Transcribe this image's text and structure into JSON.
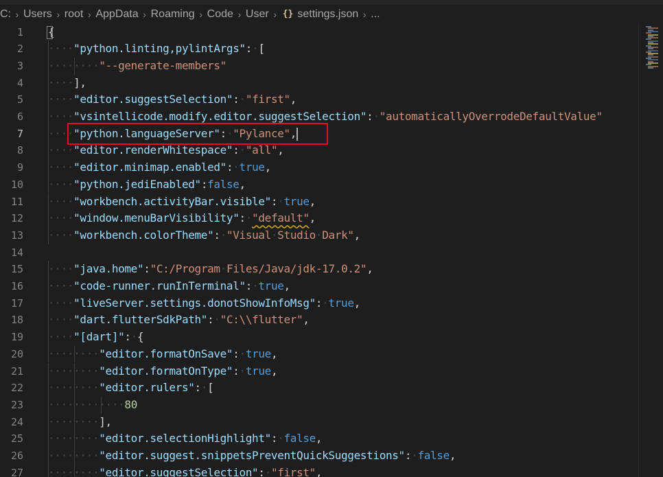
{
  "breadcrumb": {
    "items": [
      "C:",
      "Users",
      "root",
      "AppData",
      "Roaming",
      "Code",
      "User",
      "settings.json",
      "..."
    ],
    "file_icon": "{}"
  },
  "editor": {
    "active_line": 7,
    "highlighted_line": 7,
    "lines": [
      {
        "n": 1,
        "indent": 0,
        "tokens": [
          {
            "t": "p",
            "v": "{"
          }
        ]
      },
      {
        "n": 2,
        "indent": 1,
        "tokens": [
          {
            "t": "k",
            "v": "\"python.linting,pylintArgs\""
          },
          {
            "t": "p",
            "v": ": ["
          }
        ]
      },
      {
        "n": 3,
        "indent": 2,
        "tokens": [
          {
            "t": "s",
            "v": "\"--generate-members\""
          }
        ]
      },
      {
        "n": 4,
        "indent": 1,
        "tokens": [
          {
            "t": "p",
            "v": "],"
          }
        ]
      },
      {
        "n": 5,
        "indent": 1,
        "tokens": [
          {
            "t": "k",
            "v": "\"editor.suggestSelection\""
          },
          {
            "t": "p",
            "v": ": "
          },
          {
            "t": "s",
            "v": "\"first\""
          },
          {
            "t": "p",
            "v": ","
          }
        ]
      },
      {
        "n": 6,
        "indent": 1,
        "tokens": [
          {
            "t": "k",
            "v": "\"vsintellicode.modify.editor.suggestSelection\""
          },
          {
            "t": "p",
            "v": ": "
          },
          {
            "t": "s",
            "v": "\"automaticallyOverrodeDefaultValue\""
          }
        ]
      },
      {
        "n": 7,
        "indent": 1,
        "tokens": [
          {
            "t": "k",
            "v": "\"python.languageServer\""
          },
          {
            "t": "p",
            "v": ": "
          },
          {
            "t": "s",
            "v": "\"Pylance\""
          },
          {
            "t": "p",
            "v": ","
          }
        ],
        "cursor": true
      },
      {
        "n": 8,
        "indent": 1,
        "tokens": [
          {
            "t": "k",
            "v": "\"editor.renderWhitespace\""
          },
          {
            "t": "p",
            "v": ": "
          },
          {
            "t": "s",
            "v": "\"all\""
          },
          {
            "t": "p",
            "v": ","
          }
        ]
      },
      {
        "n": 9,
        "indent": 1,
        "tokens": [
          {
            "t": "k",
            "v": "\"editor.minimap.enabled\""
          },
          {
            "t": "p",
            "v": ": "
          },
          {
            "t": "b",
            "v": "true"
          },
          {
            "t": "p",
            "v": ","
          }
        ]
      },
      {
        "n": 10,
        "indent": 1,
        "tokens": [
          {
            "t": "k",
            "v": "\"python.jediEnabled\""
          },
          {
            "t": "p",
            "v": ":"
          },
          {
            "t": "b",
            "v": "false"
          },
          {
            "t": "p",
            "v": ","
          }
        ]
      },
      {
        "n": 11,
        "indent": 1,
        "tokens": [
          {
            "t": "k",
            "v": "\"workbench.activityBar.visible\""
          },
          {
            "t": "p",
            "v": ": "
          },
          {
            "t": "b",
            "v": "true"
          },
          {
            "t": "p",
            "v": ","
          }
        ]
      },
      {
        "n": 12,
        "indent": 1,
        "tokens": [
          {
            "t": "k",
            "v": "\"window.menuBarVisibility\""
          },
          {
            "t": "p",
            "v": ": "
          },
          {
            "t": "s",
            "v": "\"default\"",
            "squiggle": true
          },
          {
            "t": "p",
            "v": ","
          }
        ]
      },
      {
        "n": 13,
        "indent": 1,
        "tokens": [
          {
            "t": "k",
            "v": "\"workbench.colorTheme\""
          },
          {
            "t": "p",
            "v": ": "
          },
          {
            "t": "s",
            "v": "\"Visual Studio Dark\""
          },
          {
            "t": "p",
            "v": ","
          }
        ]
      },
      {
        "n": 14,
        "indent": 0,
        "tokens": []
      },
      {
        "n": 15,
        "indent": 1,
        "tokens": [
          {
            "t": "k",
            "v": "\"java.home\""
          },
          {
            "t": "p",
            "v": ":"
          },
          {
            "t": "s",
            "v": "\"C:/Program Files/Java/jdk-17.0.2\""
          },
          {
            "t": "p",
            "v": ","
          }
        ]
      },
      {
        "n": 16,
        "indent": 1,
        "tokens": [
          {
            "t": "k",
            "v": "\"code-runner.runInTerminal\""
          },
          {
            "t": "p",
            "v": ": "
          },
          {
            "t": "b",
            "v": "true"
          },
          {
            "t": "p",
            "v": ","
          }
        ]
      },
      {
        "n": 17,
        "indent": 1,
        "tokens": [
          {
            "t": "k",
            "v": "\"liveServer.settings.donotShowInfoMsg\""
          },
          {
            "t": "p",
            "v": ": "
          },
          {
            "t": "b",
            "v": "true"
          },
          {
            "t": "p",
            "v": ","
          }
        ]
      },
      {
        "n": 18,
        "indent": 1,
        "tokens": [
          {
            "t": "k",
            "v": "\"dart.flutterSdkPath\""
          },
          {
            "t": "p",
            "v": ": "
          },
          {
            "t": "s",
            "v": "\"C:\\\\flutter\""
          },
          {
            "t": "p",
            "v": ","
          }
        ]
      },
      {
        "n": 19,
        "indent": 1,
        "tokens": [
          {
            "t": "k",
            "v": "\"[dart]\""
          },
          {
            "t": "p",
            "v": ": {"
          }
        ]
      },
      {
        "n": 20,
        "indent": 2,
        "tokens": [
          {
            "t": "k",
            "v": "\"editor.formatOnSave\""
          },
          {
            "t": "p",
            "v": ": "
          },
          {
            "t": "b",
            "v": "true"
          },
          {
            "t": "p",
            "v": ","
          }
        ]
      },
      {
        "n": 21,
        "indent": 2,
        "tokens": [
          {
            "t": "k",
            "v": "\"editor.formatOnType\""
          },
          {
            "t": "p",
            "v": ": "
          },
          {
            "t": "b",
            "v": "true"
          },
          {
            "t": "p",
            "v": ","
          }
        ]
      },
      {
        "n": 22,
        "indent": 2,
        "tokens": [
          {
            "t": "k",
            "v": "\"editor.rulers\""
          },
          {
            "t": "p",
            "v": ": ["
          }
        ]
      },
      {
        "n": 23,
        "indent": 3,
        "tokens": [
          {
            "t": "n",
            "v": "80"
          }
        ]
      },
      {
        "n": 24,
        "indent": 2,
        "tokens": [
          {
            "t": "p",
            "v": "],"
          }
        ]
      },
      {
        "n": 25,
        "indent": 2,
        "tokens": [
          {
            "t": "k",
            "v": "\"editor.selectionHighlight\""
          },
          {
            "t": "p",
            "v": ": "
          },
          {
            "t": "b",
            "v": "false"
          },
          {
            "t": "p",
            "v": ","
          }
        ]
      },
      {
        "n": 26,
        "indent": 2,
        "tokens": [
          {
            "t": "k",
            "v": "\"editor.suggest.snippetsPreventQuickSuggestions\""
          },
          {
            "t": "p",
            "v": ": "
          },
          {
            "t": "b",
            "v": "false"
          },
          {
            "t": "p",
            "v": ","
          }
        ]
      },
      {
        "n": 27,
        "indent": 2,
        "tokens": [
          {
            "t": "k",
            "v": "\"editor.suggestSelection\""
          },
          {
            "t": "p",
            "v": ": "
          },
          {
            "t": "s",
            "v": "\"first\""
          },
          {
            "t": "p",
            "v": ","
          }
        ]
      }
    ]
  },
  "colors": {
    "background": "#1e1e1e",
    "key": "#9cdcfe",
    "string": "#ce9178",
    "boolean": "#569cd6",
    "number": "#b5cea8",
    "highlight_box": "#e0111c"
  }
}
